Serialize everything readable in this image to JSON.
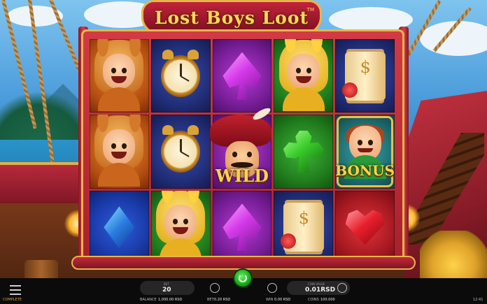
{
  "game": {
    "title": "Lost Boys Loot",
    "trademark": "TM",
    "provider_mark": "COMPLETE"
  },
  "reels": [
    [
      "fox-boy",
      "fox-boy",
      "blue-diamond"
    ],
    [
      "alarm-clock",
      "alarm-clock",
      "bunny-boy"
    ],
    [
      "purple-spade",
      "captain-hook-wild",
      "purple-spade"
    ],
    [
      "bunny-boy",
      "green-club",
      "treasure-scroll"
    ],
    [
      "treasure-scroll",
      "peter-pan-bonus",
      "red-heart"
    ]
  ],
  "symbols": {
    "wild_label": "WILD",
    "bonus_label": "BONUS"
  },
  "bar": {
    "bet_label": "BET",
    "bet_value": "20",
    "balance_label": "BALANCE",
    "balance_value": "1,000.00 RSD",
    "bet_info_label": "BET",
    "bet_info_value": "0.20 RSD",
    "win_label": "WIN",
    "win_value": "0.00 RSD",
    "coinvalue_label": "COIN VALUE",
    "coinvalue_value": "0.01RSD",
    "coins_label": "COINS",
    "coins_value": "100.000",
    "clock": "12:41"
  },
  "colors": {
    "frame": "#d23a44",
    "gold_trim": "#e8b54a",
    "spin_button": "#18a616"
  }
}
